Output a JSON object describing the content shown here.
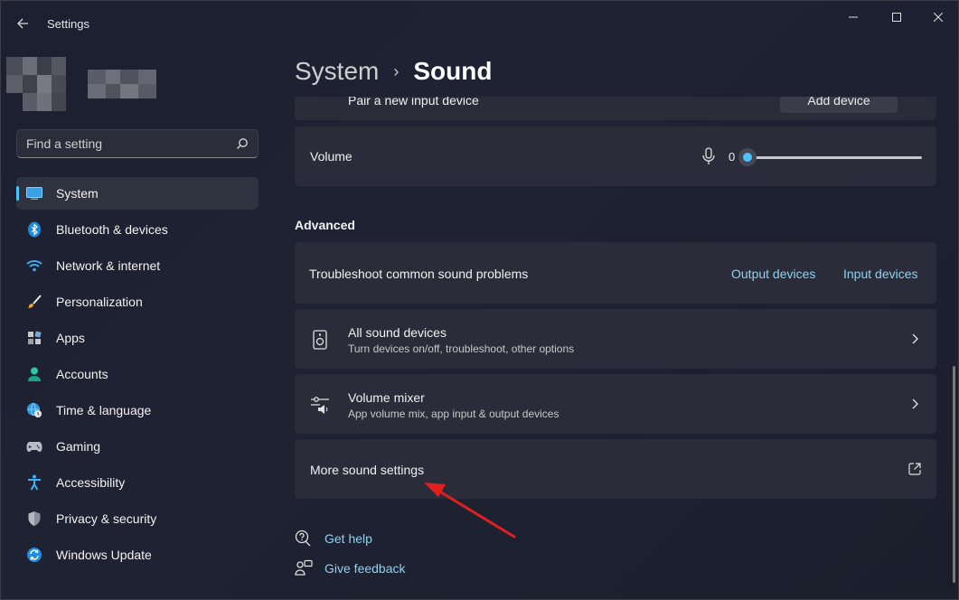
{
  "window": {
    "title": "Settings"
  },
  "search": {
    "placeholder": "Find a setting"
  },
  "nav": {
    "items": [
      {
        "label": "System",
        "icon": "monitor-icon",
        "active": true
      },
      {
        "label": "Bluetooth & devices",
        "icon": "bluetooth-icon"
      },
      {
        "label": "Network & internet",
        "icon": "wifi-icon"
      },
      {
        "label": "Personalization",
        "icon": "brush-icon"
      },
      {
        "label": "Apps",
        "icon": "apps-icon"
      },
      {
        "label": "Accounts",
        "icon": "person-icon"
      },
      {
        "label": "Time & language",
        "icon": "globe-clock-icon"
      },
      {
        "label": "Gaming",
        "icon": "gamepad-icon"
      },
      {
        "label": "Accessibility",
        "icon": "accessibility-icon"
      },
      {
        "label": "Privacy & security",
        "icon": "shield-icon"
      },
      {
        "label": "Windows Update",
        "icon": "update-icon"
      }
    ]
  },
  "breadcrumb": {
    "parent": "System",
    "separator": "›",
    "current": "Sound"
  },
  "pair_device": {
    "title": "Pair a new input device",
    "button": "Add device"
  },
  "volume": {
    "label": "Volume",
    "value": "0",
    "level": 0
  },
  "advanced": {
    "heading": "Advanced",
    "troubleshoot": {
      "title": "Troubleshoot common sound problems",
      "output_link": "Output devices",
      "input_link": "Input devices"
    },
    "all_devices": {
      "title": "All sound devices",
      "subtitle": "Turn devices on/off, troubleshoot, other options"
    },
    "mixer": {
      "title": "Volume mixer",
      "subtitle": "App volume mix, app input & output devices"
    },
    "more": {
      "title": "More sound settings"
    }
  },
  "help": {
    "get_help": "Get help",
    "feedback": "Give feedback"
  },
  "colors": {
    "accent": "#4cc2ff",
    "link": "#8fd1ee",
    "annotation_arrow": "#e0201f"
  }
}
